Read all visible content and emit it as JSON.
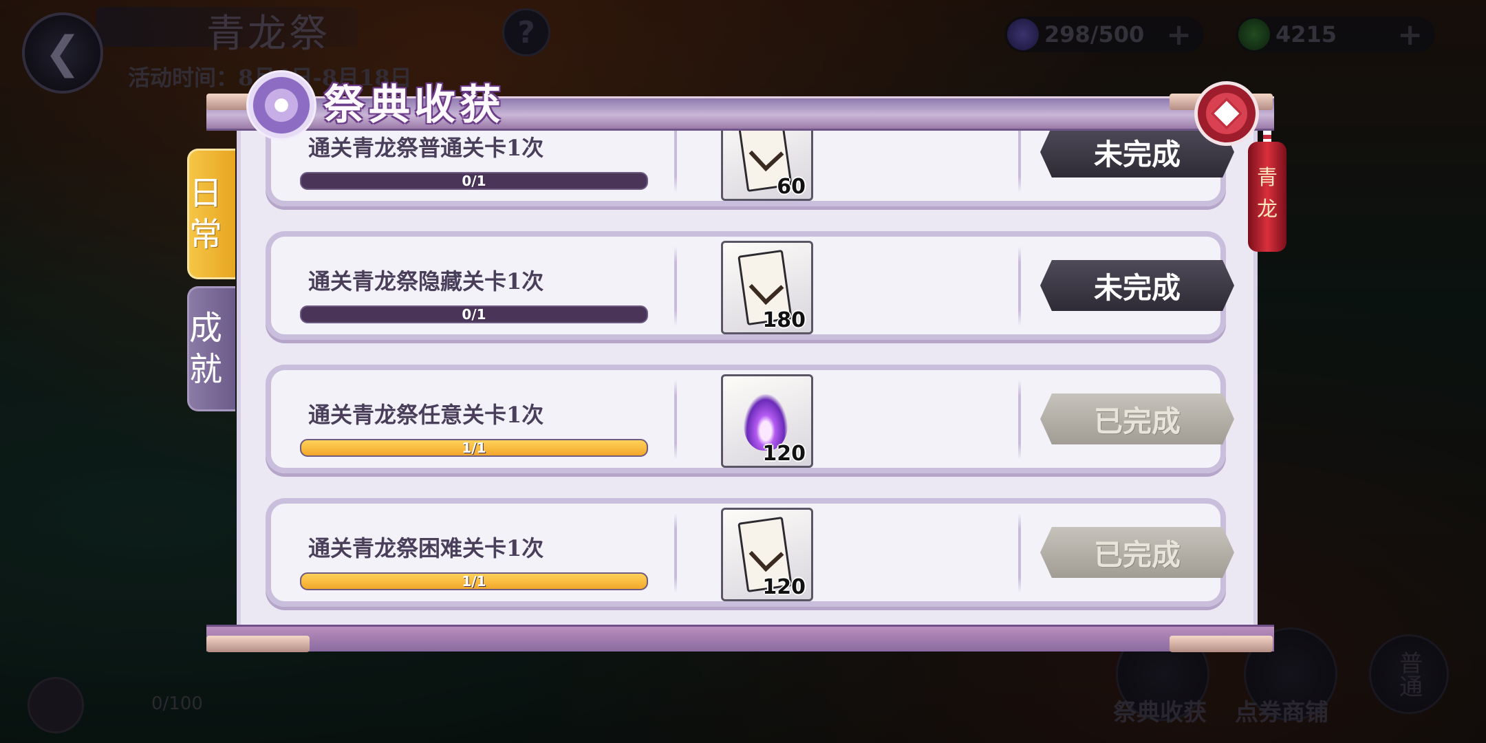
{
  "header": {
    "event_title": "青龙祭",
    "event_time": "活动时间：8月4日-8月18日",
    "help": "?",
    "stamina": "298/500",
    "coins": "4215",
    "plus": "+"
  },
  "dialog": {
    "title": "祭典收获",
    "lantern_text": "青龙",
    "tabs": [
      {
        "label": "日常",
        "active": true
      },
      {
        "label": "成就",
        "active": false
      }
    ],
    "tasks": [
      {
        "desc": "通关青龙祭普通关卡1次",
        "progress_text": "0/1",
        "progress": 0,
        "reward_type": "ticket",
        "reward_qty": "60",
        "status": "未完成",
        "done": false
      },
      {
        "desc": "通关青龙祭隐藏关卡1次",
        "progress_text": "0/1",
        "progress": 0,
        "reward_type": "ticket",
        "reward_qty": "180",
        "status": "未完成",
        "done": false
      },
      {
        "desc": "通关青龙祭任意关卡1次",
        "progress_text": "1/1",
        "progress": 1,
        "reward_type": "flame",
        "reward_qty": "120",
        "status": "已完成",
        "done": true
      },
      {
        "desc": "通关青龙祭困难关卡1次",
        "progress_text": "1/1",
        "progress": 1,
        "reward_type": "ticket",
        "reward_qty": "120",
        "status": "已完成",
        "done": true
      }
    ]
  },
  "footer": {
    "mask_count": "0/100",
    "nav": [
      {
        "label": "祭典收获"
      },
      {
        "label": "点券商铺"
      },
      {
        "label": "普通"
      }
    ]
  },
  "colors": {
    "progress_fill": "#f2a72a",
    "pending_button": "#2e2b36",
    "done_button": "#a19d94",
    "close_button": "#c4303f"
  }
}
